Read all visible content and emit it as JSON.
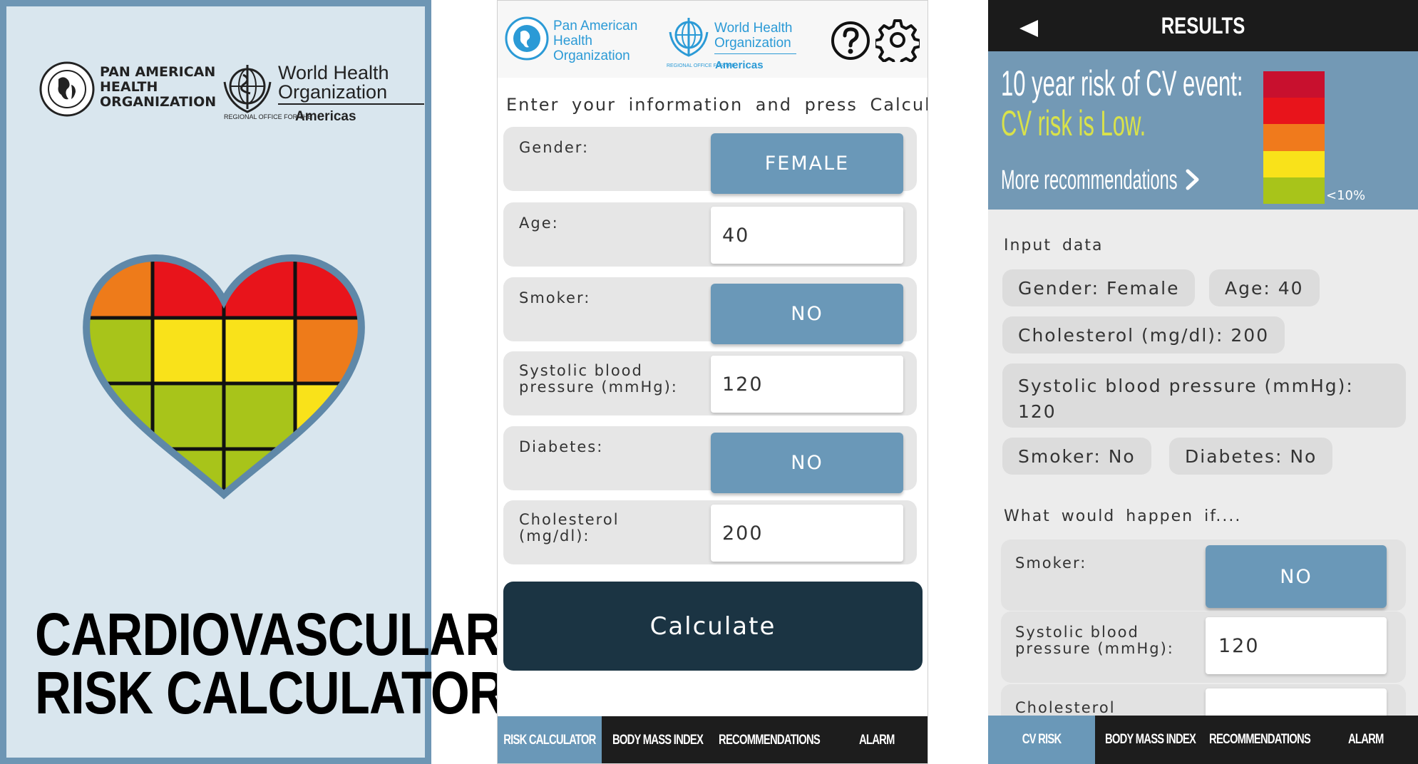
{
  "splash": {
    "paho_lines": [
      "PAN AMERICAN",
      "HEALTH",
      "ORGANIZATION"
    ],
    "who_lines": [
      "World Health",
      "Organization"
    ],
    "who_region_small": "REGIONAL OFFICE FOR THE",
    "who_region": "Americas",
    "title_lines": [
      "CARDIOVASCULAR",
      "RISK CALCULATOR"
    ]
  },
  "calculator": {
    "header": {
      "paho_lines": [
        "Pan American",
        "Health",
        "Organization"
      ],
      "who_lines": [
        "World Health",
        "Organization"
      ],
      "who_region_small": "REGIONAL OFFICE FOR THE",
      "who_region": "Americas",
      "help_icon": "question-icon",
      "settings_icon": "gear-icon"
    },
    "instruction": "Enter your information and press Calculate",
    "gender": {
      "label": "Gender:",
      "value": "FEMALE"
    },
    "age": {
      "label": "Age:",
      "value": "40"
    },
    "smoker": {
      "label": "Smoker:",
      "value": "NO"
    },
    "systolic": {
      "label_lines": [
        "Systolic blood",
        "pressure (mmHg):"
      ],
      "value": "120"
    },
    "diabetes": {
      "label": "Diabetes:",
      "value": "NO"
    },
    "cholesterol": {
      "label_lines": [
        "Cholesterol",
        "(mg/dl):"
      ],
      "value": "200"
    },
    "calculate_label": "Calculate",
    "tabs": [
      "RISK CALCULATOR",
      "BODY MASS INDEX",
      "RECOMMENDATIONS",
      "ALARM"
    ],
    "active_tab": "RISK CALCULATOR"
  },
  "results": {
    "back_icon": "back-arrow-icon",
    "title": "RESULTS",
    "risk_heading": "10 year risk of CV event:",
    "risk_level": "CV risk is Low.",
    "more_link": "More recommendations",
    "risk_percent": "<10%",
    "risk_scale_colors": [
      "#c8102e",
      "#e8141b",
      "#f07a1c",
      "#f9e21a",
      "#a8c41a"
    ],
    "risk_level_fraction": 0.2,
    "input_data_label": "Input data",
    "gender": "Gender: Female",
    "age": "Age: 40",
    "cholesterol": "Cholesterol (mg/dl): 200",
    "systolic_label": "Systolic blood pressure (mmHg):",
    "systolic_value": "120",
    "smoker": "Smoker: No",
    "diabetes": "Diabetes: No",
    "what_if_label": "What would happen if....",
    "whatif_smoker": {
      "label": "Smoker:",
      "value": "NO"
    },
    "whatif_systolic": {
      "label_lines": [
        "Systolic blood",
        "pressure (mmHg):"
      ],
      "value": "120"
    },
    "whatif_cholesterol": {
      "label": "Cholesterol"
    },
    "tabs": [
      "CV RISK",
      "BODY MASS INDEX",
      "RECOMMENDATIONS",
      "ALARM"
    ],
    "active_tab": "CV RISK"
  },
  "colors": {
    "accent_blue": "#6a98b8",
    "dark_button": "#1b3443",
    "splash_bg": "#d9e6ee",
    "risk_low_text": "#d9e24a"
  }
}
